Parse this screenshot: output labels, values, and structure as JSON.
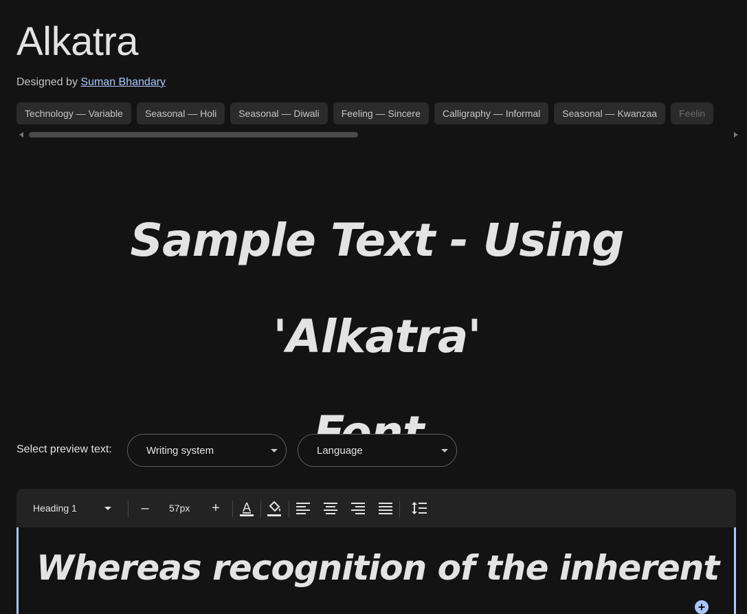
{
  "font": {
    "name": "Alkatra",
    "designed_by_label": "Designed by",
    "designer": "Suman Bhandary"
  },
  "tags": [
    "Technology — Variable",
    "Seasonal — Holi",
    "Seasonal — Diwali",
    "Feeling — Sincere",
    "Calligraphy — Informal",
    "Seasonal — Kwanzaa",
    "Feelin"
  ],
  "sample": {
    "line1": "Sample Text - Using 'Alkatra'",
    "line2": "Font."
  },
  "preview": {
    "label": "Select preview text:",
    "writing_system": "Writing system",
    "language": "Language"
  },
  "toolbar": {
    "style": "Heading 1",
    "decrease": "–",
    "size": "57px",
    "increase": "+"
  },
  "editor": {
    "text": "Whereas recognition of the inherent"
  },
  "colors": {
    "background": "#131313",
    "accent": "#a8c7fa",
    "chip": "#2b2b2b"
  }
}
